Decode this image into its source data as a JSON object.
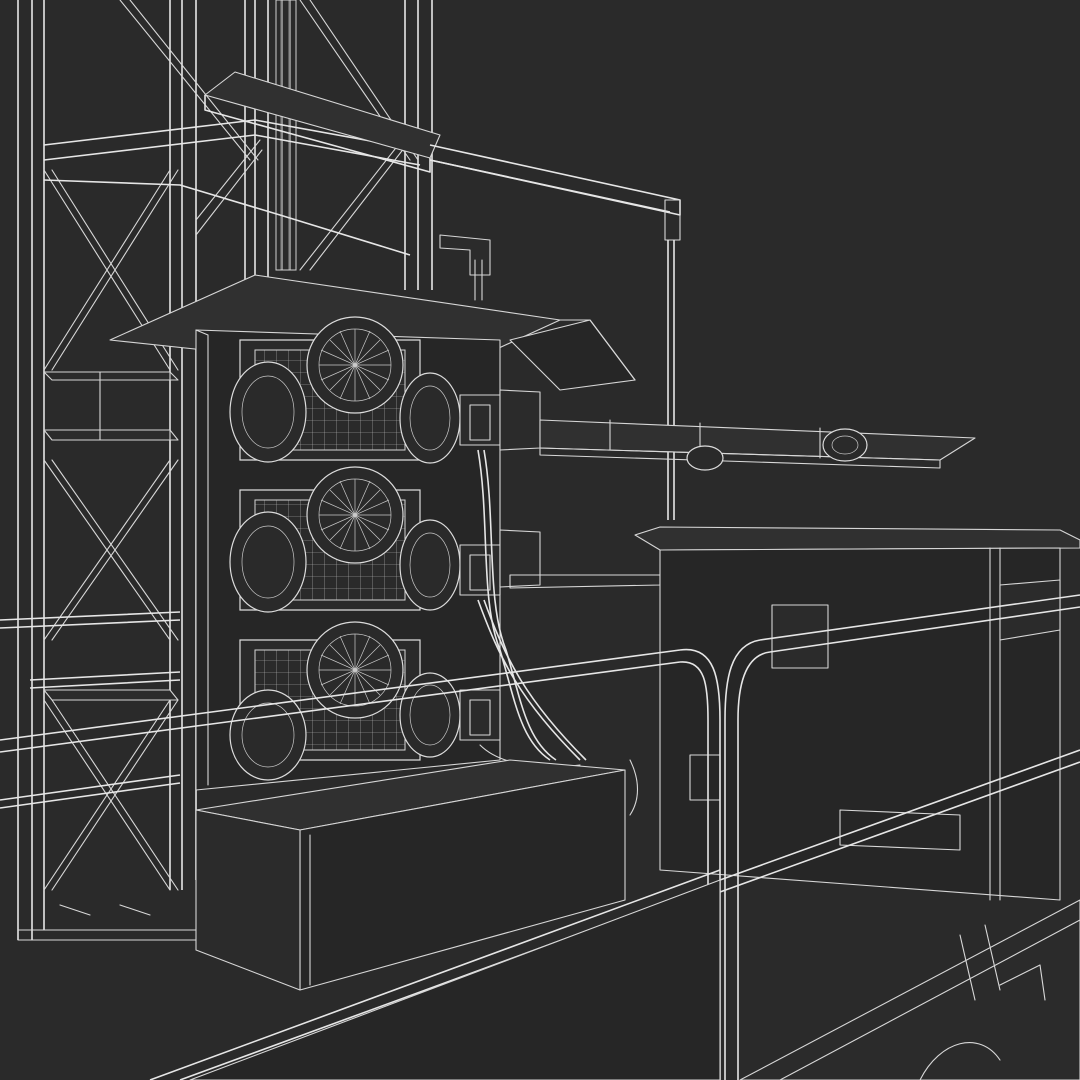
{
  "scene": {
    "style": "wireframe 3D render",
    "background_color": "#2a2a2a",
    "wire_color": "#d8d8d8",
    "motor_count": 3
  }
}
